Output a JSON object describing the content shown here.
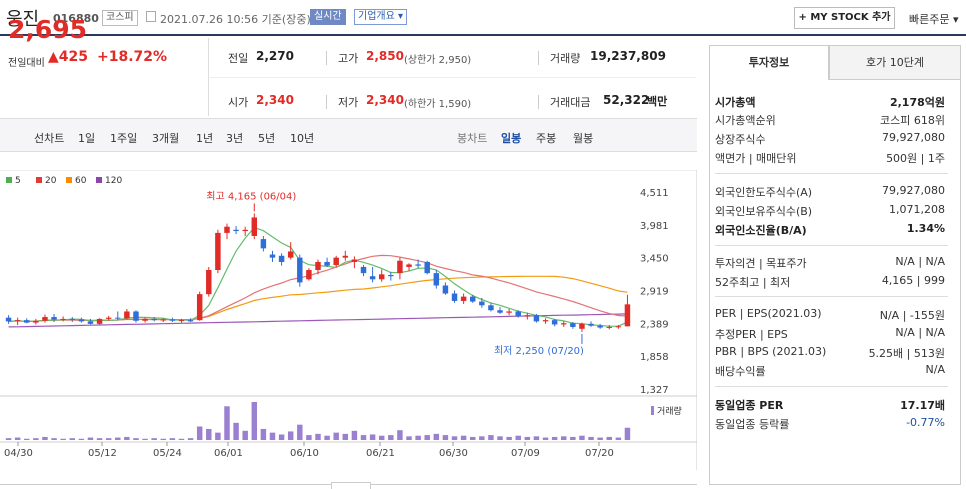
{
  "header": {
    "stock_name": "웅진",
    "stock_code": "016880",
    "market": "코스피",
    "datetime": "2021.07.26 10:56 기준(장중)",
    "realtime": "실시간",
    "overview": "기업개요 ▾",
    "mystock": "+ MY STOCK 추가",
    "quick_order": "빠른주문 ▾"
  },
  "price": {
    "current": "2,695",
    "prev_label": "전일대비",
    "change": "▲425",
    "change_pct": "+18.72%"
  },
  "quote": {
    "prev_label": "전일",
    "prev": "2,270",
    "high_label": "고가",
    "high": "2,850",
    "upper_limit": "(상한가 2,950)",
    "volume_label": "거래량",
    "volume": "19,237,809",
    "open_label": "시가",
    "open": "2,340",
    "low_label": "저가",
    "low": "2,340",
    "lower_limit": "(하한가 1,590)",
    "amount_label": "거래대금",
    "amount": "52,322",
    "amount_unit": "백만"
  },
  "toolbar": {
    "line_label": "선차트",
    "line_periods": [
      "1일",
      "1주일",
      "3개월",
      "1년",
      "3년",
      "5년",
      "10년"
    ],
    "candle_label": "봉차트",
    "candle_periods": [
      "일봉",
      "주봉",
      "월봉"
    ],
    "selected": "일봉"
  },
  "chart_data": {
    "type": "candlestick",
    "legend": [
      {
        "name": "5",
        "color": "#4caf50"
      },
      {
        "name": "20",
        "color": "#e53935"
      },
      {
        "name": "60",
        "color": "#fb8c00"
      },
      {
        "name": "120",
        "color": "#8e44ad"
      }
    ],
    "y_ticks": [
      "4,511",
      "3,981",
      "3,450",
      "2,919",
      "2,389",
      "1,858",
      "1,327"
    ],
    "ylim": [
      1327,
      4511
    ],
    "x_labels": [
      "04/30",
      "05/12",
      "05/24",
      "06/01",
      "06/10",
      "06/21",
      "06/30",
      "07/09",
      "07/20"
    ],
    "annotations": {
      "high": "최고 4,165 (06/04)",
      "low": "최저 2,250 (07/20)"
    },
    "volume_label": "거래량",
    "candles": [
      {
        "o": 2480,
        "h": 2520,
        "l": 2380,
        "c": 2420
      },
      {
        "o": 2420,
        "h": 2480,
        "l": 2360,
        "c": 2440
      },
      {
        "o": 2440,
        "h": 2470,
        "l": 2390,
        "c": 2400
      },
      {
        "o": 2400,
        "h": 2460,
        "l": 2370,
        "c": 2430
      },
      {
        "o": 2430,
        "h": 2530,
        "l": 2400,
        "c": 2490
      },
      {
        "o": 2490,
        "h": 2540,
        "l": 2410,
        "c": 2450
      },
      {
        "o": 2450,
        "h": 2500,
        "l": 2420,
        "c": 2460
      },
      {
        "o": 2460,
        "h": 2490,
        "l": 2410,
        "c": 2450
      },
      {
        "o": 2450,
        "h": 2480,
        "l": 2400,
        "c": 2420
      },
      {
        "o": 2420,
        "h": 2460,
        "l": 2370,
        "c": 2380
      },
      {
        "o": 2380,
        "h": 2470,
        "l": 2370,
        "c": 2460
      },
      {
        "o": 2460,
        "h": 2510,
        "l": 2430,
        "c": 2480
      },
      {
        "o": 2480,
        "h": 2580,
        "l": 2440,
        "c": 2470
      },
      {
        "o": 2470,
        "h": 2620,
        "l": 2450,
        "c": 2580
      },
      {
        "o": 2580,
        "h": 2600,
        "l": 2400,
        "c": 2430
      },
      {
        "o": 2430,
        "h": 2480,
        "l": 2400,
        "c": 2460
      },
      {
        "o": 2460,
        "h": 2490,
        "l": 2420,
        "c": 2440
      },
      {
        "o": 2440,
        "h": 2470,
        "l": 2410,
        "c": 2450
      },
      {
        "o": 2450,
        "h": 2480,
        "l": 2410,
        "c": 2430
      },
      {
        "o": 2430,
        "h": 2460,
        "l": 2400,
        "c": 2440
      },
      {
        "o": 2440,
        "h": 2470,
        "l": 2410,
        "c": 2420
      },
      {
        "o": 2440,
        "h": 2900,
        "l": 2430,
        "c": 2860
      },
      {
        "o": 2860,
        "h": 3300,
        "l": 2820,
        "c": 3250
      },
      {
        "o": 3250,
        "h": 3900,
        "l": 3200,
        "c": 3850
      },
      {
        "o": 3850,
        "h": 4000,
        "l": 3750,
        "c": 3950
      },
      {
        "o": 3900,
        "h": 3960,
        "l": 3830,
        "c": 3880
      },
      {
        "o": 3880,
        "h": 3950,
        "l": 3800,
        "c": 3900
      },
      {
        "o": 3800,
        "h": 4165,
        "l": 3750,
        "c": 4100
      },
      {
        "o": 3750,
        "h": 3800,
        "l": 3550,
        "c": 3600
      },
      {
        "o": 3500,
        "h": 3560,
        "l": 3380,
        "c": 3450
      },
      {
        "o": 3480,
        "h": 3520,
        "l": 3320,
        "c": 3380
      },
      {
        "o": 3450,
        "h": 3700,
        "l": 3420,
        "c": 3550
      },
      {
        "o": 3450,
        "h": 3500,
        "l": 2980,
        "c": 3050
      },
      {
        "o": 3100,
        "h": 3280,
        "l": 3080,
        "c": 3250
      },
      {
        "o": 3250,
        "h": 3420,
        "l": 3180,
        "c": 3380
      },
      {
        "o": 3380,
        "h": 3450,
        "l": 3300,
        "c": 3320
      },
      {
        "o": 3330,
        "h": 3480,
        "l": 3300,
        "c": 3450
      },
      {
        "o": 3450,
        "h": 3560,
        "l": 3400,
        "c": 3480
      },
      {
        "o": 3380,
        "h": 3470,
        "l": 3280,
        "c": 3420
      },
      {
        "o": 3300,
        "h": 3330,
        "l": 3150,
        "c": 3200
      },
      {
        "o": 3150,
        "h": 3300,
        "l": 3050,
        "c": 3100
      },
      {
        "o": 3100,
        "h": 3260,
        "l": 3060,
        "c": 3180
      },
      {
        "o": 3170,
        "h": 3220,
        "l": 3080,
        "c": 3150
      },
      {
        "o": 3200,
        "h": 3450,
        "l": 3100,
        "c": 3400
      },
      {
        "o": 3300,
        "h": 3360,
        "l": 3240,
        "c": 3340
      },
      {
        "o": 3340,
        "h": 3420,
        "l": 3280,
        "c": 3320
      },
      {
        "o": 3380,
        "h": 3400,
        "l": 3180,
        "c": 3200
      },
      {
        "o": 3200,
        "h": 3250,
        "l": 2950,
        "c": 3000
      },
      {
        "o": 3000,
        "h": 3050,
        "l": 2850,
        "c": 2870
      },
      {
        "o": 2870,
        "h": 2920,
        "l": 2720,
        "c": 2750
      },
      {
        "o": 2750,
        "h": 2870,
        "l": 2700,
        "c": 2820
      },
      {
        "o": 2820,
        "h": 2850,
        "l": 2720,
        "c": 2740
      },
      {
        "o": 2740,
        "h": 2800,
        "l": 2640,
        "c": 2680
      },
      {
        "o": 2680,
        "h": 2720,
        "l": 2580,
        "c": 2600
      },
      {
        "o": 2600,
        "h": 2650,
        "l": 2540,
        "c": 2560
      },
      {
        "o": 2560,
        "h": 2620,
        "l": 2520,
        "c": 2580
      },
      {
        "o": 2580,
        "h": 2600,
        "l": 2480,
        "c": 2500
      },
      {
        "o": 2500,
        "h": 2560,
        "l": 2450,
        "c": 2520
      },
      {
        "o": 2520,
        "h": 2540,
        "l": 2400,
        "c": 2420
      },
      {
        "o": 2420,
        "h": 2470,
        "l": 2380,
        "c": 2440
      },
      {
        "o": 2440,
        "h": 2460,
        "l": 2340,
        "c": 2370
      },
      {
        "o": 2370,
        "h": 2420,
        "l": 2330,
        "c": 2390
      },
      {
        "o": 2390,
        "h": 2410,
        "l": 2300,
        "c": 2330
      },
      {
        "o": 2300,
        "h": 2400,
        "l": 2250,
        "c": 2380
      },
      {
        "o": 2380,
        "h": 2420,
        "l": 2330,
        "c": 2350
      },
      {
        "o": 2350,
        "h": 2380,
        "l": 2300,
        "c": 2320
      },
      {
        "o": 2320,
        "h": 2360,
        "l": 2290,
        "c": 2330
      },
      {
        "o": 2330,
        "h": 2360,
        "l": 2300,
        "c": 2340
      },
      {
        "o": 2340,
        "h": 2850,
        "l": 2340,
        "c": 2695
      }
    ],
    "volumes": [
      3,
      4,
      2,
      3,
      5,
      3,
      2,
      3,
      2,
      4,
      3,
      3,
      4,
      5,
      3,
      2,
      3,
      2,
      3,
      2,
      3,
      22,
      18,
      12,
      55,
      28,
      15,
      62,
      18,
      12,
      9,
      14,
      25,
      8,
      10,
      7,
      12,
      10,
      15,
      8,
      9,
      7,
      8,
      16,
      6,
      7,
      8,
      10,
      8,
      6,
      7,
      5,
      6,
      8,
      6,
      5,
      7,
      5,
      6,
      4,
      5,
      6,
      5,
      7,
      5,
      4,
      5,
      4,
      20
    ]
  },
  "side": {
    "tab_info": "투자정보",
    "tab_quote": "호가 10단계",
    "market_cap_label": "시가총액",
    "market_cap": "2,178억원",
    "cap_rank_label": "시가총액순위",
    "cap_rank": "코스피 618위",
    "shares_label": "상장주식수",
    "shares": "79,927,080",
    "par_label": "액면가 | 매매단위",
    "par": "500원 | 1주",
    "foreign_limit_label": "외국인한도주식수(A)",
    "foreign_limit": "79,927,080",
    "foreign_hold_label": "외국인보유주식수(B)",
    "foreign_hold": "1,071,208",
    "foreign_ratio_label": "외국인소진율(B/A)",
    "foreign_ratio": "1.34%",
    "opinion_label": "투자의견 | 목표주가",
    "opinion": "N/A | N/A",
    "week52_label": "52주최고 | 최저",
    "week52": "4,165 | 999",
    "per_label": "PER | EPS(2021.03)",
    "per": "N/A | -155원",
    "est_per_label": "추정PER | EPS",
    "est_per": "N/A | N/A",
    "pbr_label": "PBR | BPS (2021.03)",
    "pbr": "5.25배 | 513원",
    "dividend_label": "배당수익률",
    "dividend": "N/A",
    "industry_per_label": "동일업종 PER",
    "industry_per": "17.17배",
    "industry_rate_label": "동일업종 등락률",
    "industry_rate": "-0.77%"
  }
}
